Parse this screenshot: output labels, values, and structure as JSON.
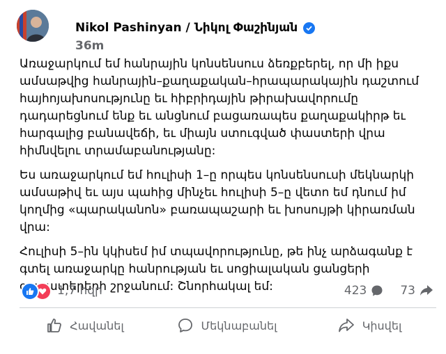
{
  "post": {
    "author": "Nikol Pashinyan / Նիկոլ Փաշինյան",
    "time": "36m",
    "paragraphs": [
      "Առաջարկում եմ հանրային կոնսենսուս ձեռքբերել, որ մի իքս ամսաթվից հանրային–քաղաքական–հրապարակային դաշտում հայհոյախոսությունը եւ հիբրիդային թիրախավորումը դադարեցնում ենք եւ անցնում բացառապես քաղաքակիրթ եւ հարգալից բանավեճի, եւ միայն ստուգված փաստերի վրա հիմնվելու տրամաբանությանը:",
      "Ես առաջարկում եմ հուլիսի 1–ը որպես կոնսենսուսի մեկնարկի ամսաթիվ եւ այս պահից մինչեւ հուլիսի 5–ը վետո եմ դնում իմ կողմից «պարականոն» բառապաշարի եւ խոսույթի կիրառման վրա:",
      "Հուլիսի 5–ին կկիսեմ իմ տպավորությունը, թե ինչ արձագանք է գտել առաջարկը հանրության եւ սոցիալական ցանցերի օգտատերերի շրջանում: Շնորհակալ եմ:"
    ]
  },
  "reactions": {
    "count": "1,7 հզր",
    "comments": "423",
    "shares": "73",
    "icons": [
      "like-icon",
      "love-icon",
      "comment-icon",
      "share-icon"
    ]
  },
  "actions": {
    "like": "Հավանել",
    "comment": "Մեկնաբանել",
    "share": "Կիսվել"
  },
  "colors": {
    "accent": "#1877f2",
    "love": "#f33e58",
    "secondary_text": "#65676b"
  }
}
